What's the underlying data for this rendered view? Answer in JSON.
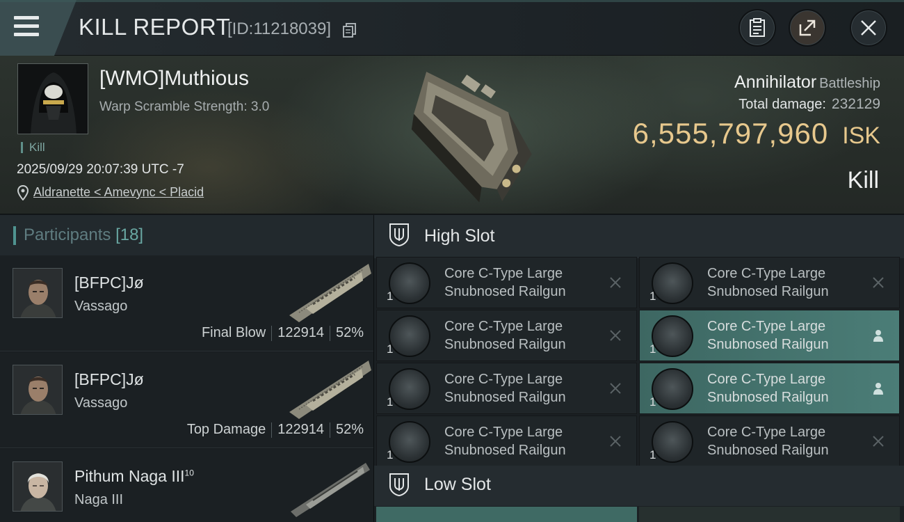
{
  "header": {
    "title": "KILL REPORT",
    "report_id": "[ID:11218039]"
  },
  "victim": {
    "name": "[WMO]Muthious",
    "warp_scramble": "Warp Scramble Strength: 3.0",
    "tag": "Kill",
    "datetime": "2025/09/29 20:07:39 UTC -7",
    "location": "Aldranette < Amevync < Placid",
    "ship_name": "Annihilator",
    "ship_class": "Battleship",
    "total_damage_label": "Total damage:",
    "total_damage": "232129",
    "isk_value": "6,555,797,960",
    "isk_unit": "ISK",
    "result": "Kill"
  },
  "participants": {
    "label": "Participants",
    "count": "[18]",
    "rows": [
      {
        "name": "[BFPC]Jø",
        "ship": "Vassago",
        "role": "Final Blow",
        "damage": "122914",
        "percent": "52%"
      },
      {
        "name": "[BFPC]Jø",
        "ship": "Vassago",
        "role": "Top Damage",
        "damage": "122914",
        "percent": "52%"
      },
      {
        "name": "Pithum Naga III",
        "level": "10",
        "ship": "Naga III"
      }
    ]
  },
  "slots": {
    "high_label": "High Slot",
    "low_label": "Low Slot",
    "high": [
      {
        "line1": "Core C-Type Large",
        "line2": "Snubnosed Railgun",
        "qty": "1",
        "state": "destroyed"
      },
      {
        "line1": "Core C-Type Large",
        "line2": "Snubnosed Railgun",
        "qty": "1",
        "state": "destroyed"
      },
      {
        "line1": "Core C-Type Large",
        "line2": "Snubnosed Railgun",
        "qty": "1",
        "state": "destroyed"
      },
      {
        "line1": "Core C-Type Large",
        "line2": "Snubnosed Railgun",
        "qty": "1",
        "state": "dropped"
      },
      {
        "line1": "Core C-Type Large",
        "line2": "Snubnosed Railgun",
        "qty": "1",
        "state": "destroyed"
      },
      {
        "line1": "Core C-Type Large",
        "line2": "Snubnosed Railgun",
        "qty": "1",
        "state": "dropped"
      },
      {
        "line1": "Core C-Type Large",
        "line2": "Snubnosed Railgun",
        "qty": "1",
        "state": "destroyed"
      },
      {
        "line1": "Core C-Type Large",
        "line2": "Snubnosed Railgun",
        "qty": "1",
        "state": "destroyed"
      }
    ]
  },
  "icons": {
    "menu": "hamburger-icon",
    "copy": "copy-icon",
    "report": "clipboard-icon",
    "share": "share-icon",
    "close": "close-icon",
    "location": "map-pin-icon",
    "destroyed": "x-icon",
    "dropped": "person-icon"
  },
  "colors": {
    "isk": "#e7c88d",
    "accent": "#4f9390",
    "fitted": "#4b7d77"
  }
}
